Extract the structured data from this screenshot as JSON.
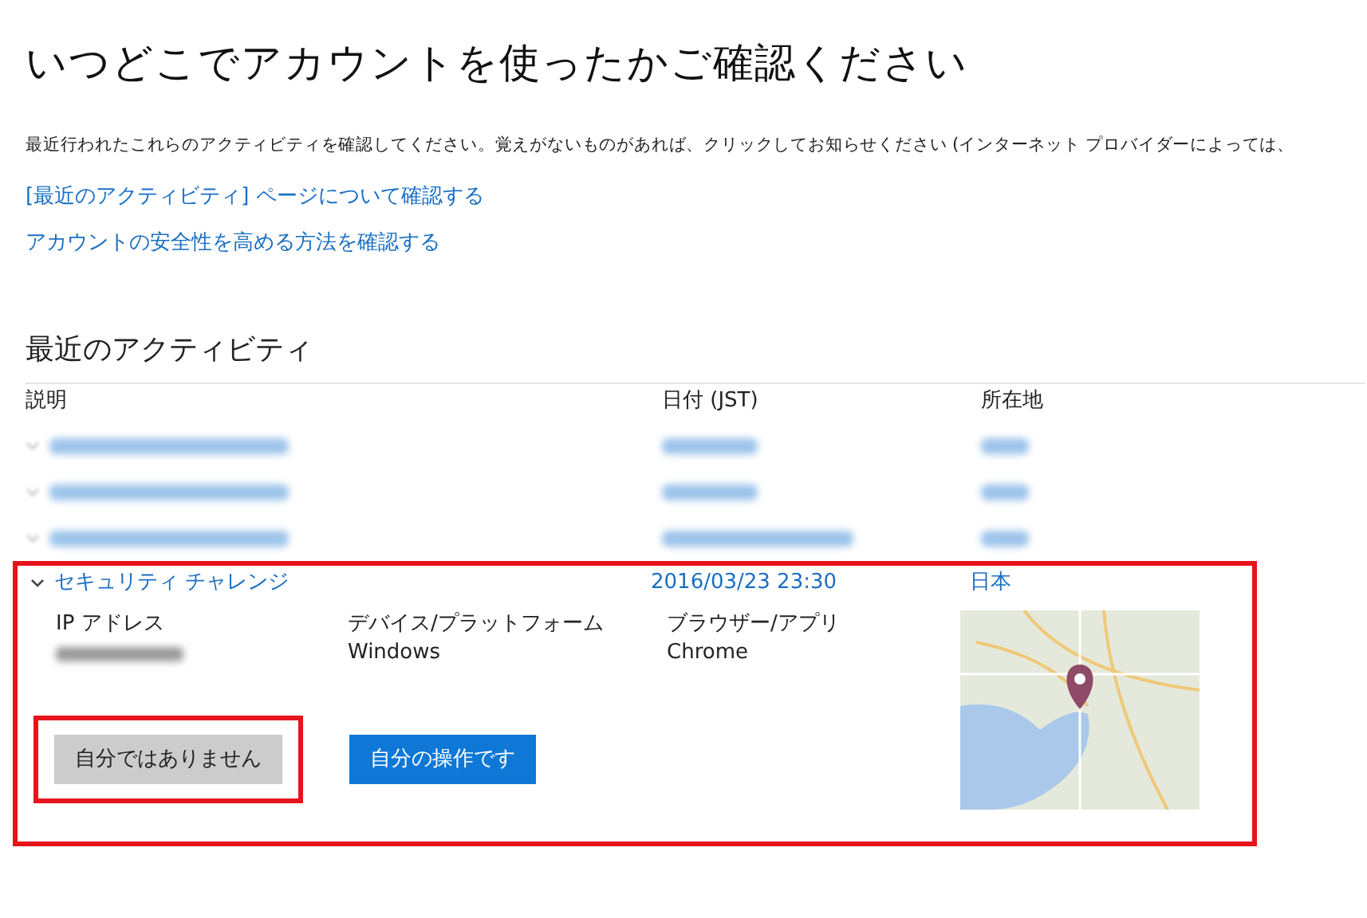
{
  "page_title": "いつどこでアカウントを使ったかご確認ください",
  "intro": "最近行われたこれらのアクティビティを確認してください。覚えがないものがあれば、クリックしてお知らせください (インターネット プロバイダーによっては、",
  "links": [
    "[最近のアクティビティ] ページについて確認する",
    "アカウントの安全性を高める方法を確認する"
  ],
  "section_title": "最近のアクティビティ",
  "table": {
    "columns": [
      "説明",
      "日付 (JST)",
      "所在地"
    ],
    "rows": [
      {
        "kind": "redacted",
        "expanded": false
      },
      {
        "kind": "redacted",
        "expanded": false
      },
      {
        "kind": "redacted",
        "expanded": false
      },
      {
        "kind": "entry",
        "expanded": true,
        "highlighted": true,
        "description": "セキュリティ チャレンジ",
        "date": "2016/03/23 23:30",
        "location": "日本",
        "details": [
          {
            "label": "IP アドレス",
            "redacted": true
          },
          {
            "label": "デバイス/プラットフォーム",
            "value": "Windows"
          },
          {
            "label": "ブラウザー/アプリ",
            "value": "Chrome"
          }
        ],
        "buttons": [
          {
            "label": "自分ではありません",
            "kind": "secondary",
            "highlighted": true
          },
          {
            "label": "自分の操作です",
            "kind": "primary",
            "highlighted": false
          }
        ]
      }
    ]
  }
}
